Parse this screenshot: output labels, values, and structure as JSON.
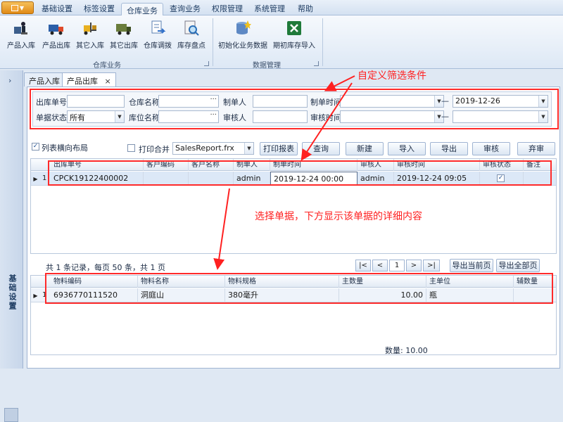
{
  "menu": {
    "tabs": [
      "基础设置",
      "标签设置",
      "仓库业务",
      "查询业务",
      "权限管理",
      "系统管理",
      "帮助"
    ],
    "active_tab": "仓库业务"
  },
  "ribbon": {
    "group1_buttons": [
      "产品入库",
      "产品出库",
      "其它入库",
      "其它出库",
      "仓库调拨",
      "库存盘点"
    ],
    "group1_label": "仓库业务",
    "group2_buttons": [
      "初始化业务数据",
      "期初库存导入"
    ],
    "group2_label": "数据管理"
  },
  "left_panel": {
    "vertical_label": "基础设置",
    "chevron": "›"
  },
  "doc_tabs": {
    "tab1": "产品入库",
    "tab2": "产品出库",
    "close": "×"
  },
  "filters": {
    "row1": {
      "outbound_no_label": "出库单号",
      "warehouse_label": "仓库名称",
      "creator_label": "制单人",
      "create_time_label": "制单时间",
      "dash": "—",
      "date_to": "2019-12-26"
    },
    "row2": {
      "status_label": "单据状态",
      "status_value": "所有",
      "location_label": "库位名称",
      "reviewer_label": "审核人",
      "review_time_label": "审核时间",
      "dash": "—"
    }
  },
  "toolbar": {
    "list_layout_label": "列表横向布局",
    "print_merge_label": "打印合并",
    "report_file": "SalesReport.frx",
    "buttons": [
      "打印报表",
      "查询",
      "新建",
      "导入",
      "导出",
      "审核",
      "弃审"
    ]
  },
  "master_grid": {
    "columns": [
      "出库单号",
      "客户编码",
      "客户名称",
      "制单人",
      "制单时间",
      "审核人",
      "审核时间",
      "审核状态",
      "备注"
    ],
    "rows": [
      {
        "rownum": "1",
        "order_no": "CPCK19122400002",
        "customer_code": "",
        "customer_name": "",
        "creator": "admin",
        "create_time": "2019-12-24 00:00",
        "reviewer": "admin",
        "review_time": "2019-12-24 09:05",
        "reviewed": true,
        "remark": ""
      }
    ]
  },
  "pager": {
    "summary": "共 1 条记录，每页 50 条，共 1 页",
    "first": "|<",
    "prev": "<",
    "page": "1",
    "next": ">",
    "last": ">|",
    "export_current": "导出当前页",
    "export_all": "导出全部页"
  },
  "detail_grid": {
    "columns": [
      "物料编码",
      "物料名称",
      "物料规格",
      "主数量",
      "主单位",
      "辅数量"
    ],
    "rows": [
      {
        "rownum": "1",
        "code": "6936770111520",
        "name": "洞庭山",
        "spec": "380毫升",
        "qty": "10.00",
        "unit": "瓶",
        "aux_qty": ""
      }
    ]
  },
  "footer": {
    "qty_sum": "数量: 10.00"
  },
  "annotations": {
    "top": "自定义筛选条件",
    "middle": "选择单据，下方显示该单据的详细内容"
  },
  "colors": {
    "annotation_red": "#ff2020",
    "selected_row": "#dce8f7",
    "ribbon_bg": "#dde8f5"
  }
}
